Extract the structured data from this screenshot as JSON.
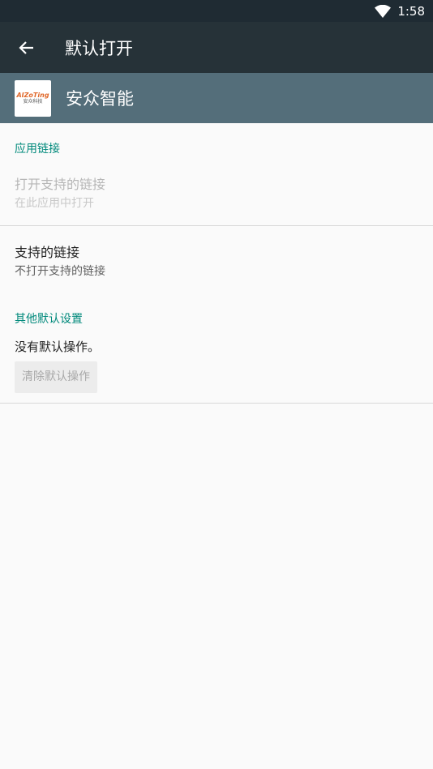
{
  "status_bar": {
    "time": "1:58",
    "wifi_icon": "wifi-icon"
  },
  "toolbar": {
    "back_icon": "arrow-back-icon",
    "title": "默认打开"
  },
  "app": {
    "icon_line1": "AIZoTing",
    "icon_line2": "安众科技",
    "name": "安众智能"
  },
  "app_links": {
    "section_title": "应用链接",
    "open_supported": {
      "title": "打开支持的链接",
      "summary": "在此应用中打开"
    },
    "supported_links": {
      "title": "支持的链接",
      "summary": "不打开支持的链接"
    }
  },
  "other_defaults": {
    "section_title": "其他默认设置",
    "no_default_text": "没有默认操作。",
    "clear_button_label": "清除默认操作"
  },
  "colors": {
    "status_bar": "#1f2b33",
    "toolbar": "#263238",
    "app_header": "#546e7a",
    "accent": "#00897b"
  }
}
